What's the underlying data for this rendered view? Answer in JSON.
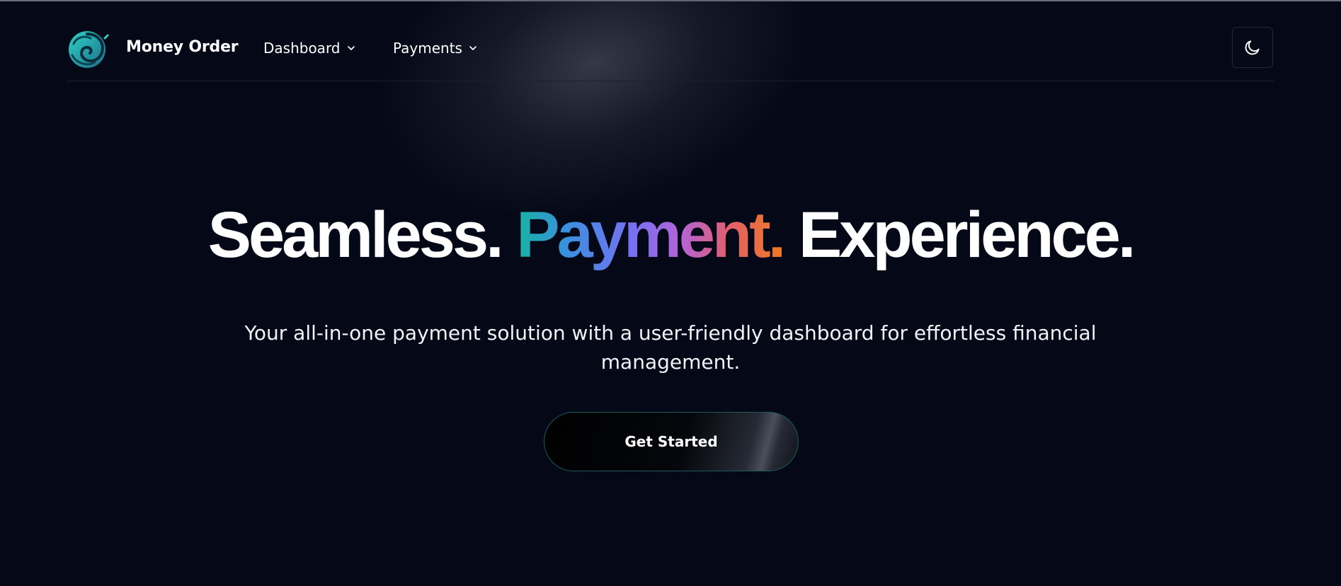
{
  "header": {
    "brand_name": "Money Order",
    "logo_icon": "swirl-logo-icon",
    "nav": [
      {
        "label": "Dashboard",
        "icon": "chevron-down-icon"
      },
      {
        "label": "Payments",
        "icon": "chevron-down-icon"
      }
    ],
    "theme_toggle_icon": "moon-icon"
  },
  "hero": {
    "title_part1": "Seamless.",
    "title_highlight": "Payment.",
    "title_part3": "Experience.",
    "subtitle": "Your all-in-one payment solution with a user-friendly dashboard for effortless financial management.",
    "cta_label": "Get Started"
  },
  "colors": {
    "background": "#040817",
    "gradient_start": "#16b3a2",
    "gradient_mid": "#7b6ff2",
    "gradient_end": "#f07a22",
    "cta_border": "#1e5a5c"
  }
}
